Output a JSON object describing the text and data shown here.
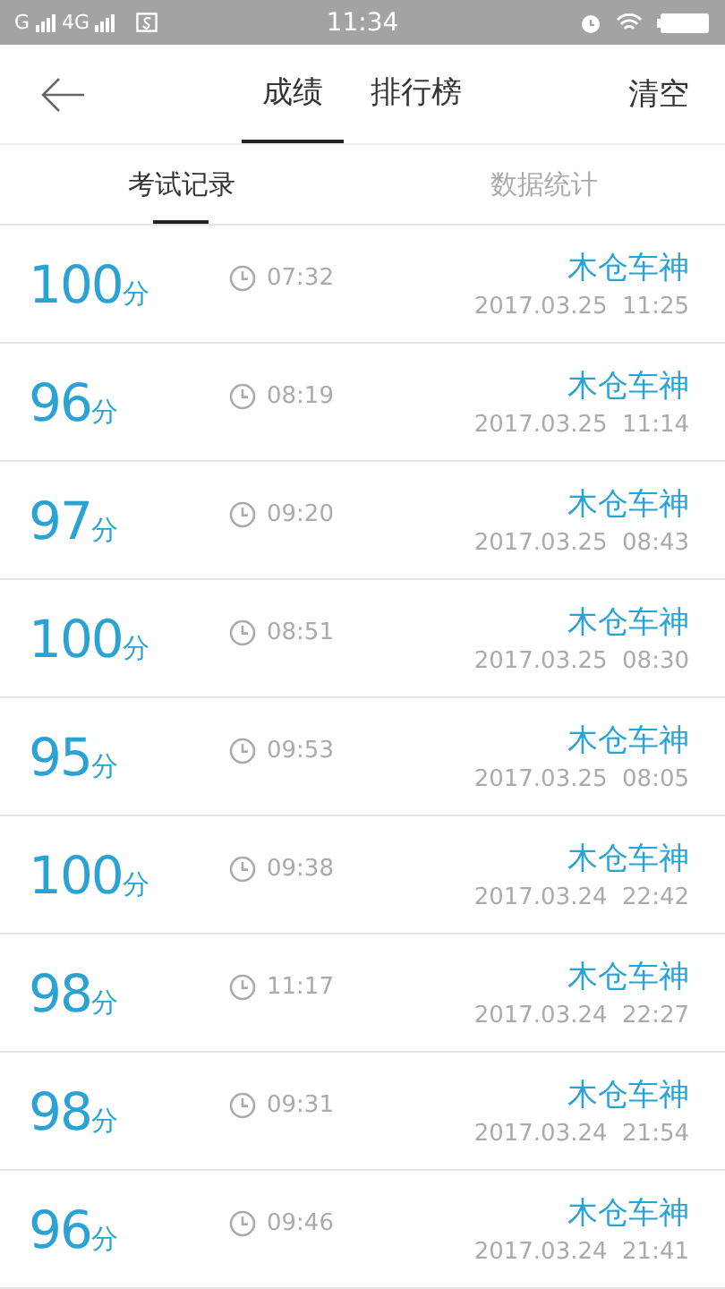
{
  "status_bar": {
    "network_1": "G",
    "network_2": "4G",
    "time": "11:34"
  },
  "header": {
    "tabs": [
      {
        "label": "成绩",
        "selected": true
      },
      {
        "label": "排行榜",
        "selected": false
      }
    ],
    "action": "清空"
  },
  "sub_tabs": [
    {
      "label": "考试记录",
      "selected": true
    },
    {
      "label": "数据统计",
      "selected": false
    }
  ],
  "records": [
    {
      "score": "100",
      "unit": "分",
      "duration": "07:32",
      "title": "木仓车神",
      "date": "2017.03.25  11:25"
    },
    {
      "score": "96",
      "unit": "分",
      "duration": "08:19",
      "title": "木仓车神",
      "date": "2017.03.25  11:14"
    },
    {
      "score": "97",
      "unit": "分",
      "duration": "09:20",
      "title": "木仓车神",
      "date": "2017.03.25  08:43"
    },
    {
      "score": "100",
      "unit": "分",
      "duration": "08:51",
      "title": "木仓车神",
      "date": "2017.03.25  08:30"
    },
    {
      "score": "95",
      "unit": "分",
      "duration": "09:53",
      "title": "木仓车神",
      "date": "2017.03.25  08:05"
    },
    {
      "score": "100",
      "unit": "分",
      "duration": "09:38",
      "title": "木仓车神",
      "date": "2017.03.24  22:42"
    },
    {
      "score": "98",
      "unit": "分",
      "duration": "11:17",
      "title": "木仓车神",
      "date": "2017.03.24  22:27"
    },
    {
      "score": "98",
      "unit": "分",
      "duration": "09:31",
      "title": "木仓车神",
      "date": "2017.03.24  21:54"
    },
    {
      "score": "96",
      "unit": "分",
      "duration": "09:46",
      "title": "木仓车神",
      "date": "2017.03.24  21:41"
    }
  ]
}
